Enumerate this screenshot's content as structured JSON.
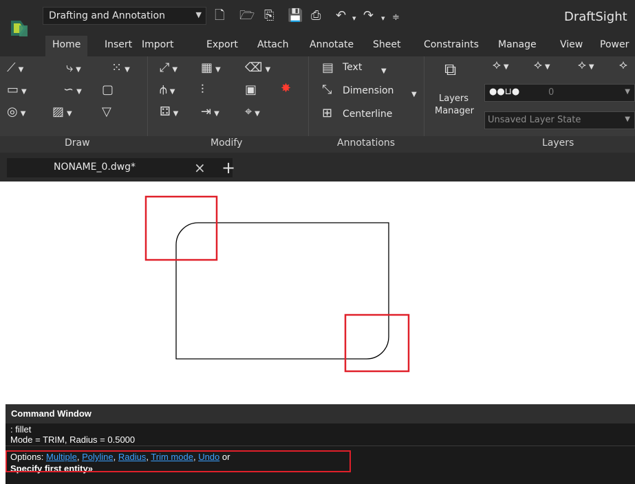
{
  "app": {
    "name": "DraftSight",
    "workspace": "Drafting and Annotation"
  },
  "ribbon_tabs": [
    "Home",
    "Insert",
    "Import",
    "Export",
    "Attach",
    "Annotate",
    "Sheet",
    "Constraints",
    "Manage",
    "View",
    "Power"
  ],
  "active_tab": "Home",
  "annotate": {
    "text_label": "Text",
    "dimension_label": "Dimension",
    "centerline_label": "Centerline"
  },
  "layers": {
    "manager_line1": "Layers",
    "manager_line2": "Manager",
    "current_layer": "0",
    "layer_state": "Unsaved Layer State"
  },
  "panels": {
    "draw": "Draw",
    "modify": "Modify",
    "annotations": "Annotations",
    "layers": "Layers"
  },
  "document": {
    "tab_name": "NONAME_0.dwg*"
  },
  "command_window": {
    "title": "Command Window",
    "line1": ": fillet",
    "line2": "Mode = TRIM, Radius = 0.5000",
    "options_prefix": "Options:",
    "options": [
      "Multiple",
      "Polyline",
      "Radius",
      "Trim mode",
      "Undo"
    ],
    "options_suffix": "or",
    "prompt": "Specify first entity»"
  },
  "colors": {
    "highlight": "#e0202a",
    "option_link": "#3aa0ff",
    "logo_accent": "#b6d33a"
  }
}
